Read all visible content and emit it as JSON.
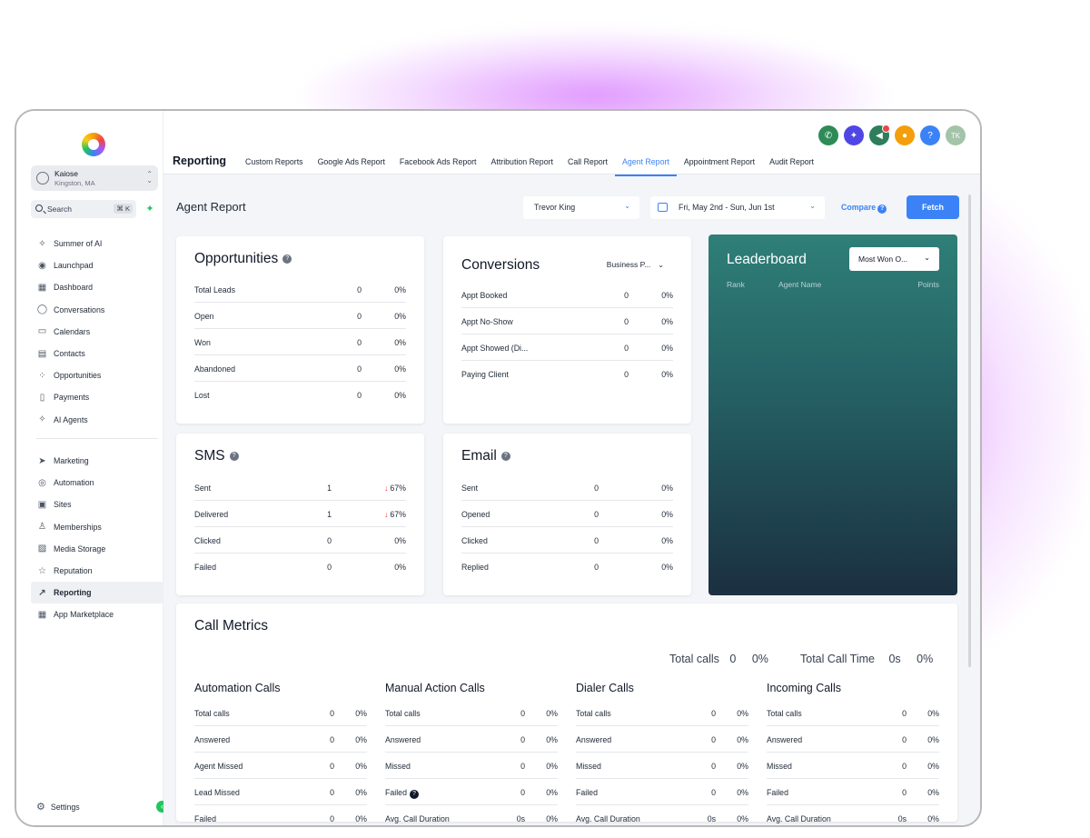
{
  "account": {
    "name": "Kaiose",
    "location": "Kingston, MA"
  },
  "search": {
    "label": "Search",
    "shortcut": "⌘ K"
  },
  "nav_main": [
    {
      "label": "Summer of AI",
      "icon": "sparkle-icon",
      "glyph": "✧"
    },
    {
      "label": "Launchpad",
      "icon": "rocket-icon",
      "glyph": "◉"
    },
    {
      "label": "Dashboard",
      "icon": "grid-icon",
      "glyph": "▦"
    },
    {
      "label": "Conversations",
      "icon": "chat-icon",
      "glyph": "◯"
    },
    {
      "label": "Calendars",
      "icon": "calendar-icon",
      "glyph": "▭"
    },
    {
      "label": "Contacts",
      "icon": "contacts-icon",
      "glyph": "▤"
    },
    {
      "label": "Opportunities",
      "icon": "pipeline-icon",
      "glyph": "⁘"
    },
    {
      "label": "Payments",
      "icon": "receipt-icon",
      "glyph": "▯"
    },
    {
      "label": "AI Agents",
      "icon": "sparkle-icon",
      "glyph": "✧"
    }
  ],
  "nav_secondary": [
    {
      "label": "Marketing",
      "icon": "send-icon",
      "glyph": "➤",
      "active": false
    },
    {
      "label": "Automation",
      "icon": "automation-icon",
      "glyph": "◎",
      "active": false
    },
    {
      "label": "Sites",
      "icon": "globe-icon",
      "glyph": "▣",
      "active": false
    },
    {
      "label": "Memberships",
      "icon": "badge-icon",
      "glyph": "♙",
      "active": false
    },
    {
      "label": "Media Storage",
      "icon": "image-icon",
      "glyph": "▨",
      "active": false
    },
    {
      "label": "Reputation",
      "icon": "star-icon",
      "glyph": "☆",
      "active": false
    },
    {
      "label": "Reporting",
      "icon": "trend-icon",
      "glyph": "↗",
      "active": true
    },
    {
      "label": "App Marketplace",
      "icon": "apps-icon",
      "glyph": "▦",
      "active": false
    }
  ],
  "settings_label": "Settings",
  "header": {
    "title": "Reporting",
    "tabs": [
      {
        "label": "Custom Reports",
        "active": false
      },
      {
        "label": "Google Ads Report",
        "active": false
      },
      {
        "label": "Facebook Ads Report",
        "active": false
      },
      {
        "label": "Attribution Report",
        "active": false
      },
      {
        "label": "Call Report",
        "active": false
      },
      {
        "label": "Agent Report",
        "active": true
      },
      {
        "label": "Appointment Report",
        "active": false
      },
      {
        "label": "Audit Report",
        "active": false
      }
    ],
    "icons": [
      {
        "name": "phone-icon",
        "glyph": "✆",
        "color": "#2e8b57"
      },
      {
        "name": "magic-icon",
        "glyph": "✦",
        "color": "#4f46e5"
      },
      {
        "name": "megaphone-icon",
        "glyph": "◀",
        "color": "#2e7d5b"
      },
      {
        "name": "bell-icon",
        "glyph": "●",
        "color": "#f59e0b"
      },
      {
        "name": "help-icon",
        "glyph": "?",
        "color": "#3b82f6"
      },
      {
        "name": "avatar",
        "glyph": "TK",
        "color": "#a3c4a8"
      }
    ]
  },
  "filters": {
    "report_title": "Agent Report",
    "agent": "Trevor King",
    "date_range": "Fri, May 2nd - Sun, Jun 1st",
    "compare": "Compare",
    "fetch": "Fetch"
  },
  "opportunities": {
    "title": "Opportunities",
    "rows": [
      {
        "label": "Total Leads",
        "count": "0",
        "pct": "0%"
      },
      {
        "label": "Open",
        "count": "0",
        "pct": "0%"
      },
      {
        "label": "Won",
        "count": "0",
        "pct": "0%"
      },
      {
        "label": "Abandoned",
        "count": "0",
        "pct": "0%"
      },
      {
        "label": "Lost",
        "count": "0",
        "pct": "0%"
      }
    ]
  },
  "conversions": {
    "title": "Conversions",
    "dropdown": "Business P...",
    "rows": [
      {
        "label": "Appt Booked",
        "count": "0",
        "pct": "0%"
      },
      {
        "label": "Appt No-Show",
        "count": "0",
        "pct": "0%"
      },
      {
        "label": "Appt Showed (Di...",
        "count": "0",
        "pct": "0%"
      },
      {
        "label": "Paying Client",
        "count": "0",
        "pct": "0%"
      }
    ]
  },
  "sms": {
    "title": "SMS",
    "rows": [
      {
        "label": "Sent",
        "count": "1",
        "pct": "67%",
        "down": true
      },
      {
        "label": "Delivered",
        "count": "1",
        "pct": "67%",
        "down": true
      },
      {
        "label": "Clicked",
        "count": "0",
        "pct": "0%",
        "down": false
      },
      {
        "label": "Failed",
        "count": "0",
        "pct": "0%",
        "down": false
      }
    ]
  },
  "email": {
    "title": "Email",
    "rows": [
      {
        "label": "Sent",
        "count": "0",
        "pct": "0%"
      },
      {
        "label": "Opened",
        "count": "0",
        "pct": "0%"
      },
      {
        "label": "Clicked",
        "count": "0",
        "pct": "0%"
      },
      {
        "label": "Replied",
        "count": "0",
        "pct": "0%"
      }
    ]
  },
  "leaderboard": {
    "title": "Leaderboard",
    "dropdown": "Most Won O...",
    "columns": [
      "Rank",
      "Agent Name",
      "Points"
    ]
  },
  "call_metrics": {
    "title": "Call Metrics",
    "total_calls_label": "Total calls",
    "total_calls_value": "0",
    "total_calls_pct": "0%",
    "total_time_label": "Total Call Time",
    "total_time_value": "0s",
    "total_time_pct": "0%",
    "columns": [
      {
        "title": "Automation Calls",
        "rows": [
          {
            "label": "Total calls",
            "count": "0",
            "pct": "0%"
          },
          {
            "label": "Answered",
            "count": "0",
            "pct": "0%"
          },
          {
            "label": "Agent Missed",
            "count": "0",
            "pct": "0%"
          },
          {
            "label": "Lead Missed",
            "count": "0",
            "pct": "0%"
          },
          {
            "label": "Failed",
            "count": "0",
            "pct": "0%"
          }
        ]
      },
      {
        "title": "Manual Action Calls",
        "rows": [
          {
            "label": "Total calls",
            "count": "0",
            "pct": "0%"
          },
          {
            "label": "Answered",
            "count": "0",
            "pct": "0%"
          },
          {
            "label": "Missed",
            "count": "0",
            "pct": "0%"
          },
          {
            "label": "Failed",
            "count": "0",
            "pct": "0%",
            "help": true
          },
          {
            "label": "Avg. Call Duration",
            "count": "0s",
            "pct": "0%"
          }
        ]
      },
      {
        "title": "Dialer Calls",
        "rows": [
          {
            "label": "Total calls",
            "count": "0",
            "pct": "0%"
          },
          {
            "label": "Answered",
            "count": "0",
            "pct": "0%"
          },
          {
            "label": "Missed",
            "count": "0",
            "pct": "0%"
          },
          {
            "label": "Failed",
            "count": "0",
            "pct": "0%"
          },
          {
            "label": "Avg. Call Duration",
            "count": "0s",
            "pct": "0%"
          }
        ]
      },
      {
        "title": "Incoming Calls",
        "rows": [
          {
            "label": "Total calls",
            "count": "0",
            "pct": "0%"
          },
          {
            "label": "Answered",
            "count": "0",
            "pct": "0%"
          },
          {
            "label": "Missed",
            "count": "0",
            "pct": "0%"
          },
          {
            "label": "Failed",
            "count": "0",
            "pct": "0%"
          },
          {
            "label": "Avg. Call Duration",
            "count": "0s",
            "pct": "0%"
          }
        ]
      }
    ]
  }
}
